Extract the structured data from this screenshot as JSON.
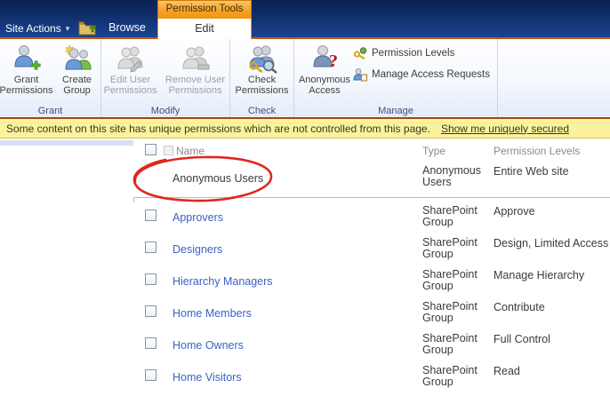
{
  "chrome": {
    "site_actions": "Site Actions",
    "caret": "▾",
    "browse": "Browse",
    "permission_tools": "Permission Tools",
    "edit": "Edit"
  },
  "ribbon": {
    "buttons": {
      "grant_permissions": "Grant Permissions",
      "create_group": "Create Group",
      "edit_user_permissions": "Edit User Permissions",
      "remove_user_permissions": "Remove User Permissions",
      "check_permissions": "Check Permissions",
      "anonymous_access": "Anonymous Access",
      "permission_levels": "Permission Levels",
      "manage_access_requests": "Manage Access Requests"
    },
    "group_labels": {
      "grant": "Grant",
      "modify": "Modify",
      "check": "Check",
      "manage": "Manage"
    }
  },
  "status": {
    "message": "Some content on this site has unique permissions which are not controlled from this page.",
    "link": "Show me uniquely secured"
  },
  "table": {
    "header": {
      "name": "Name",
      "type": "Type",
      "permissions": "Permission Levels"
    },
    "anonymous_row": {
      "name": "Anonymous Users",
      "type": "Anonymous Users",
      "permissions": "Entire Web site"
    },
    "rows": [
      {
        "name": "Approvers",
        "type": "SharePoint Group",
        "permissions": "Approve"
      },
      {
        "name": "Designers",
        "type": "SharePoint Group",
        "permissions": "Design, Limited Access"
      },
      {
        "name": "Hierarchy Managers",
        "type": "SharePoint Group",
        "permissions": "Manage Hierarchy"
      },
      {
        "name": "Home Members",
        "type": "SharePoint Group",
        "permissions": "Contribute"
      },
      {
        "name": "Home Owners",
        "type": "SharePoint Group",
        "permissions": "Full Control"
      },
      {
        "name": "Home Visitors",
        "type": "SharePoint Group",
        "permissions": "Read"
      }
    ]
  },
  "colors": {
    "top_bar_navy": "#10306e",
    "contextual_orange": "#f6a226",
    "status_yellow": "#fbf2a0",
    "status_border": "#9c4c09",
    "link_blue": "#3a63c4",
    "annotation_red": "#e0271c"
  }
}
